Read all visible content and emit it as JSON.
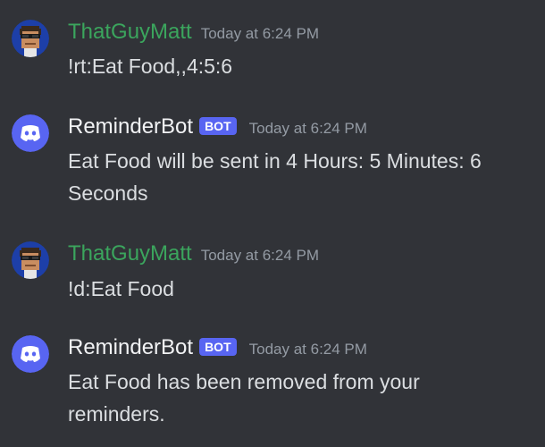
{
  "messages": [
    {
      "author": "ThatGuyMatt",
      "avatar": "pixel-sunglasses-avatar-icon",
      "is_bot": false,
      "timestamp": "Today at 6:24 PM",
      "content": "!rt:Eat Food,,4:5:6"
    },
    {
      "author": "ReminderBot",
      "avatar": "discord-logo-avatar-icon",
      "is_bot": true,
      "bot_tag": "BOT",
      "timestamp": "Today at 6:24 PM",
      "content_line1": "Eat Food will be sent in 4 Hours: 5 Minutes: 6",
      "content_line2": "Seconds"
    },
    {
      "author": "ThatGuyMatt",
      "avatar": "pixel-sunglasses-avatar-icon",
      "is_bot": false,
      "timestamp": "Today at 6:24 PM",
      "content": "!d:Eat Food"
    },
    {
      "author": "ReminderBot",
      "avatar": "discord-logo-avatar-icon",
      "is_bot": true,
      "bot_tag": "BOT",
      "timestamp": "Today at 6:24 PM",
      "content_line1": "Eat Food has been removed from your",
      "content_line2": "reminders."
    }
  ],
  "colors": {
    "background": "#313338",
    "user_name": "#3ba55d",
    "bot_name": "#f2f3f5",
    "bot_tag": "#5865f2",
    "timestamp": "#949ba4",
    "text": "#dbdee1"
  }
}
